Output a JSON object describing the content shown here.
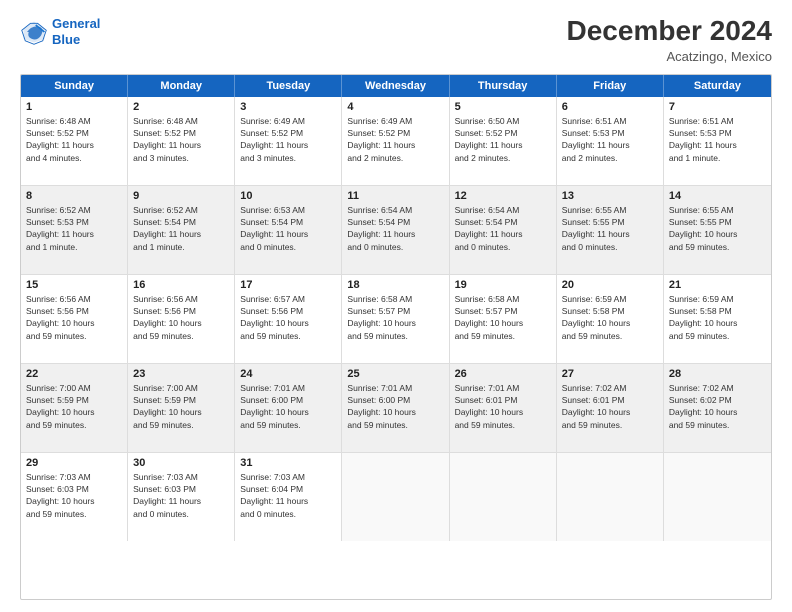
{
  "header": {
    "logo_line1": "General",
    "logo_line2": "Blue",
    "month_title": "December 2024",
    "location": "Acatzingo, Mexico"
  },
  "days_of_week": [
    "Sunday",
    "Monday",
    "Tuesday",
    "Wednesday",
    "Thursday",
    "Friday",
    "Saturday"
  ],
  "weeks": [
    [
      {
        "day": "1",
        "info": "Sunrise: 6:48 AM\nSunset: 5:52 PM\nDaylight: 11 hours\nand 4 minutes."
      },
      {
        "day": "2",
        "info": "Sunrise: 6:48 AM\nSunset: 5:52 PM\nDaylight: 11 hours\nand 3 minutes."
      },
      {
        "day": "3",
        "info": "Sunrise: 6:49 AM\nSunset: 5:52 PM\nDaylight: 11 hours\nand 3 minutes."
      },
      {
        "day": "4",
        "info": "Sunrise: 6:49 AM\nSunset: 5:52 PM\nDaylight: 11 hours\nand 2 minutes."
      },
      {
        "day": "5",
        "info": "Sunrise: 6:50 AM\nSunset: 5:52 PM\nDaylight: 11 hours\nand 2 minutes."
      },
      {
        "day": "6",
        "info": "Sunrise: 6:51 AM\nSunset: 5:53 PM\nDaylight: 11 hours\nand 2 minutes."
      },
      {
        "day": "7",
        "info": "Sunrise: 6:51 AM\nSunset: 5:53 PM\nDaylight: 11 hours\nand 1 minute."
      }
    ],
    [
      {
        "day": "8",
        "info": "Sunrise: 6:52 AM\nSunset: 5:53 PM\nDaylight: 11 hours\nand 1 minute."
      },
      {
        "day": "9",
        "info": "Sunrise: 6:52 AM\nSunset: 5:54 PM\nDaylight: 11 hours\nand 1 minute."
      },
      {
        "day": "10",
        "info": "Sunrise: 6:53 AM\nSunset: 5:54 PM\nDaylight: 11 hours\nand 0 minutes."
      },
      {
        "day": "11",
        "info": "Sunrise: 6:54 AM\nSunset: 5:54 PM\nDaylight: 11 hours\nand 0 minutes."
      },
      {
        "day": "12",
        "info": "Sunrise: 6:54 AM\nSunset: 5:54 PM\nDaylight: 11 hours\nand 0 minutes."
      },
      {
        "day": "13",
        "info": "Sunrise: 6:55 AM\nSunset: 5:55 PM\nDaylight: 11 hours\nand 0 minutes."
      },
      {
        "day": "14",
        "info": "Sunrise: 6:55 AM\nSunset: 5:55 PM\nDaylight: 10 hours\nand 59 minutes."
      }
    ],
    [
      {
        "day": "15",
        "info": "Sunrise: 6:56 AM\nSunset: 5:56 PM\nDaylight: 10 hours\nand 59 minutes."
      },
      {
        "day": "16",
        "info": "Sunrise: 6:56 AM\nSunset: 5:56 PM\nDaylight: 10 hours\nand 59 minutes."
      },
      {
        "day": "17",
        "info": "Sunrise: 6:57 AM\nSunset: 5:56 PM\nDaylight: 10 hours\nand 59 minutes."
      },
      {
        "day": "18",
        "info": "Sunrise: 6:58 AM\nSunset: 5:57 PM\nDaylight: 10 hours\nand 59 minutes."
      },
      {
        "day": "19",
        "info": "Sunrise: 6:58 AM\nSunset: 5:57 PM\nDaylight: 10 hours\nand 59 minutes."
      },
      {
        "day": "20",
        "info": "Sunrise: 6:59 AM\nSunset: 5:58 PM\nDaylight: 10 hours\nand 59 minutes."
      },
      {
        "day": "21",
        "info": "Sunrise: 6:59 AM\nSunset: 5:58 PM\nDaylight: 10 hours\nand 59 minutes."
      }
    ],
    [
      {
        "day": "22",
        "info": "Sunrise: 7:00 AM\nSunset: 5:59 PM\nDaylight: 10 hours\nand 59 minutes."
      },
      {
        "day": "23",
        "info": "Sunrise: 7:00 AM\nSunset: 5:59 PM\nDaylight: 10 hours\nand 59 minutes."
      },
      {
        "day": "24",
        "info": "Sunrise: 7:01 AM\nSunset: 6:00 PM\nDaylight: 10 hours\nand 59 minutes."
      },
      {
        "day": "25",
        "info": "Sunrise: 7:01 AM\nSunset: 6:00 PM\nDaylight: 10 hours\nand 59 minutes."
      },
      {
        "day": "26",
        "info": "Sunrise: 7:01 AM\nSunset: 6:01 PM\nDaylight: 10 hours\nand 59 minutes."
      },
      {
        "day": "27",
        "info": "Sunrise: 7:02 AM\nSunset: 6:01 PM\nDaylight: 10 hours\nand 59 minutes."
      },
      {
        "day": "28",
        "info": "Sunrise: 7:02 AM\nSunset: 6:02 PM\nDaylight: 10 hours\nand 59 minutes."
      }
    ],
    [
      {
        "day": "29",
        "info": "Sunrise: 7:03 AM\nSunset: 6:03 PM\nDaylight: 10 hours\nand 59 minutes."
      },
      {
        "day": "30",
        "info": "Sunrise: 7:03 AM\nSunset: 6:03 PM\nDaylight: 11 hours\nand 0 minutes."
      },
      {
        "day": "31",
        "info": "Sunrise: 7:03 AM\nSunset: 6:04 PM\nDaylight: 11 hours\nand 0 minutes."
      },
      {
        "day": "",
        "info": ""
      },
      {
        "day": "",
        "info": ""
      },
      {
        "day": "",
        "info": ""
      },
      {
        "day": "",
        "info": ""
      }
    ]
  ]
}
